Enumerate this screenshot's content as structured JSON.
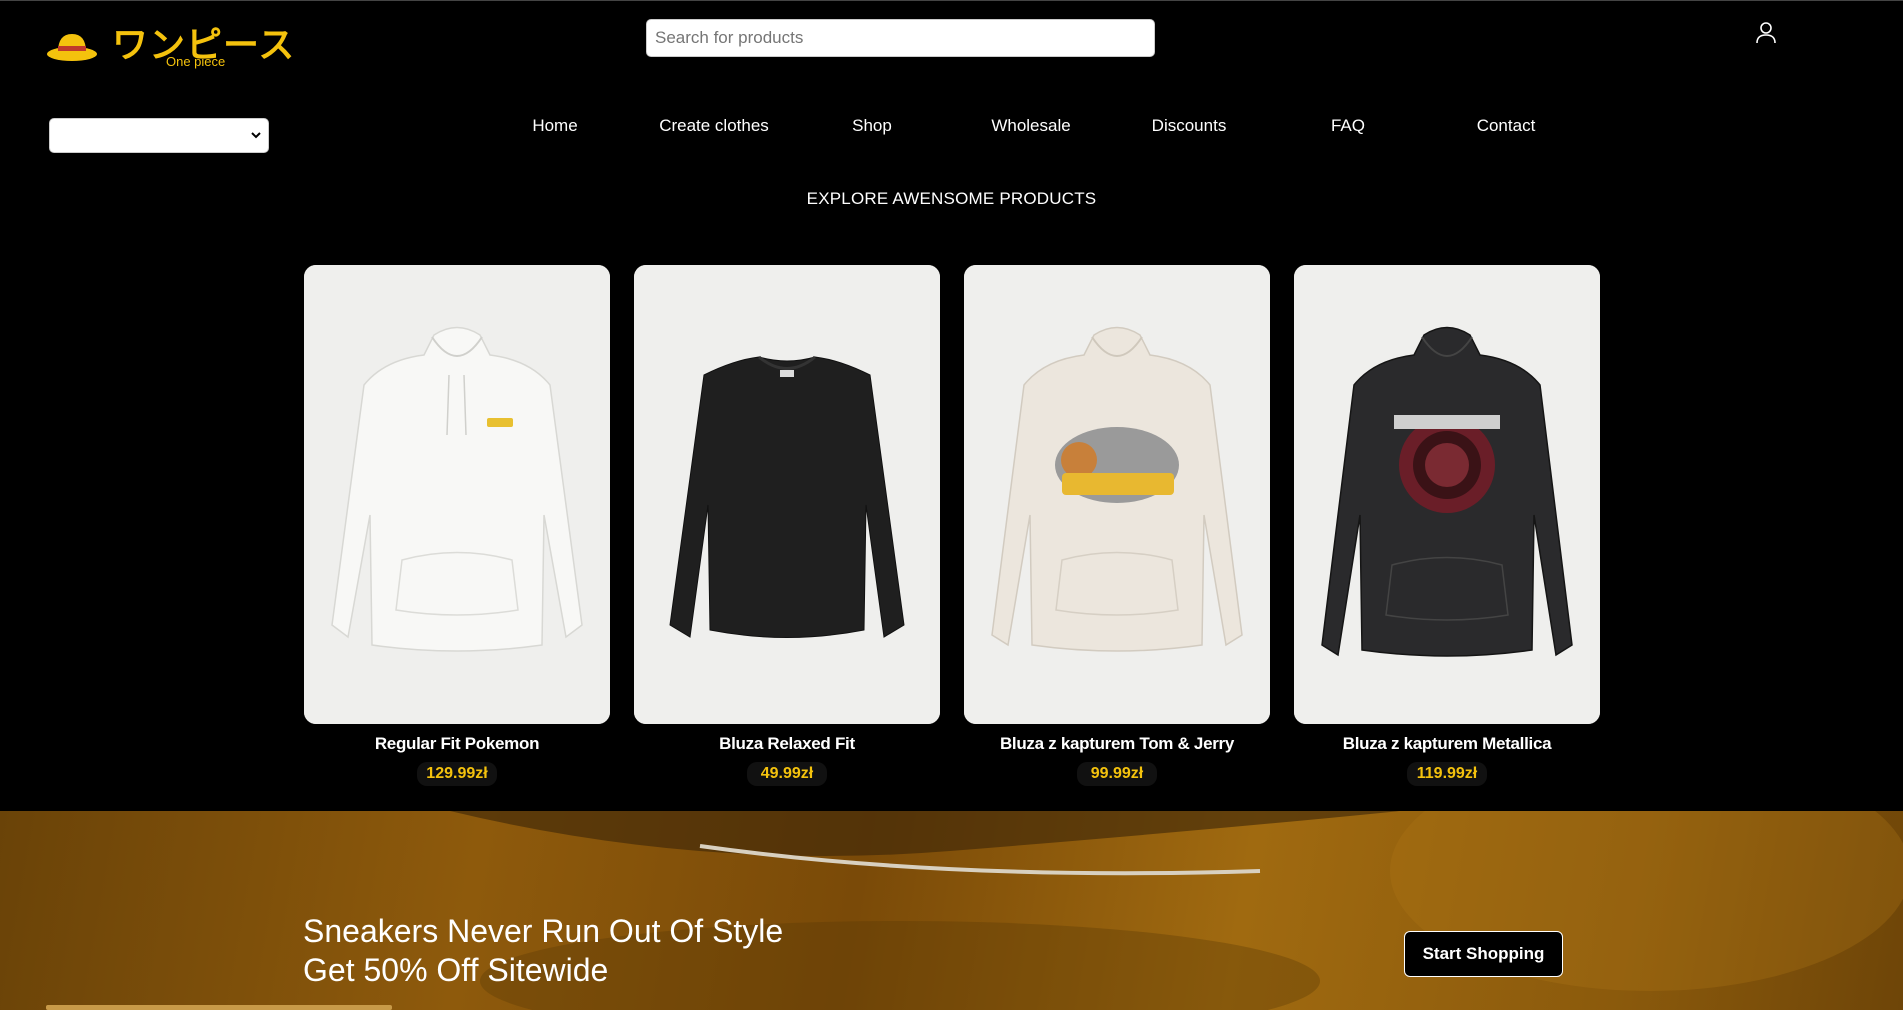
{
  "header": {
    "logo_text": "ワンピース",
    "logo_subtitle": "One piece",
    "search_placeholder": "Search for products",
    "user_icon": "user-icon"
  },
  "filter_select": {
    "value": ""
  },
  "nav": {
    "items": [
      {
        "label": "Home"
      },
      {
        "label": "Create clothes"
      },
      {
        "label": "Shop"
      },
      {
        "label": "Wholesale"
      },
      {
        "label": "Discounts"
      },
      {
        "label": "FAQ"
      },
      {
        "label": "Contact"
      }
    ]
  },
  "section": {
    "title": "EXPLORE AWENSOME PRODUCTS"
  },
  "products": [
    {
      "name": "Regular Fit Pokemon",
      "price": "129.99zł",
      "garment": "white-hoodie"
    },
    {
      "name": "Bluza Relaxed Fit",
      "price": "49.99zł",
      "garment": "black-sweatshirt"
    },
    {
      "name": "Bluza z kapturem Tom & Jerry",
      "price": "99.99zł",
      "garment": "cream-hoodie"
    },
    {
      "name": "Bluza z kapturem Metallica",
      "price": "119.99zł",
      "garment": "black-hoodie"
    }
  ],
  "banner": {
    "line1": "Sneakers Never Run Out Of Style",
    "line2": "Get 50% Off Sitewide",
    "button_label": "Start Shopping"
  },
  "colors": {
    "accent": "#f4c20d",
    "background": "#000000",
    "banner": "#8e5a0c"
  }
}
